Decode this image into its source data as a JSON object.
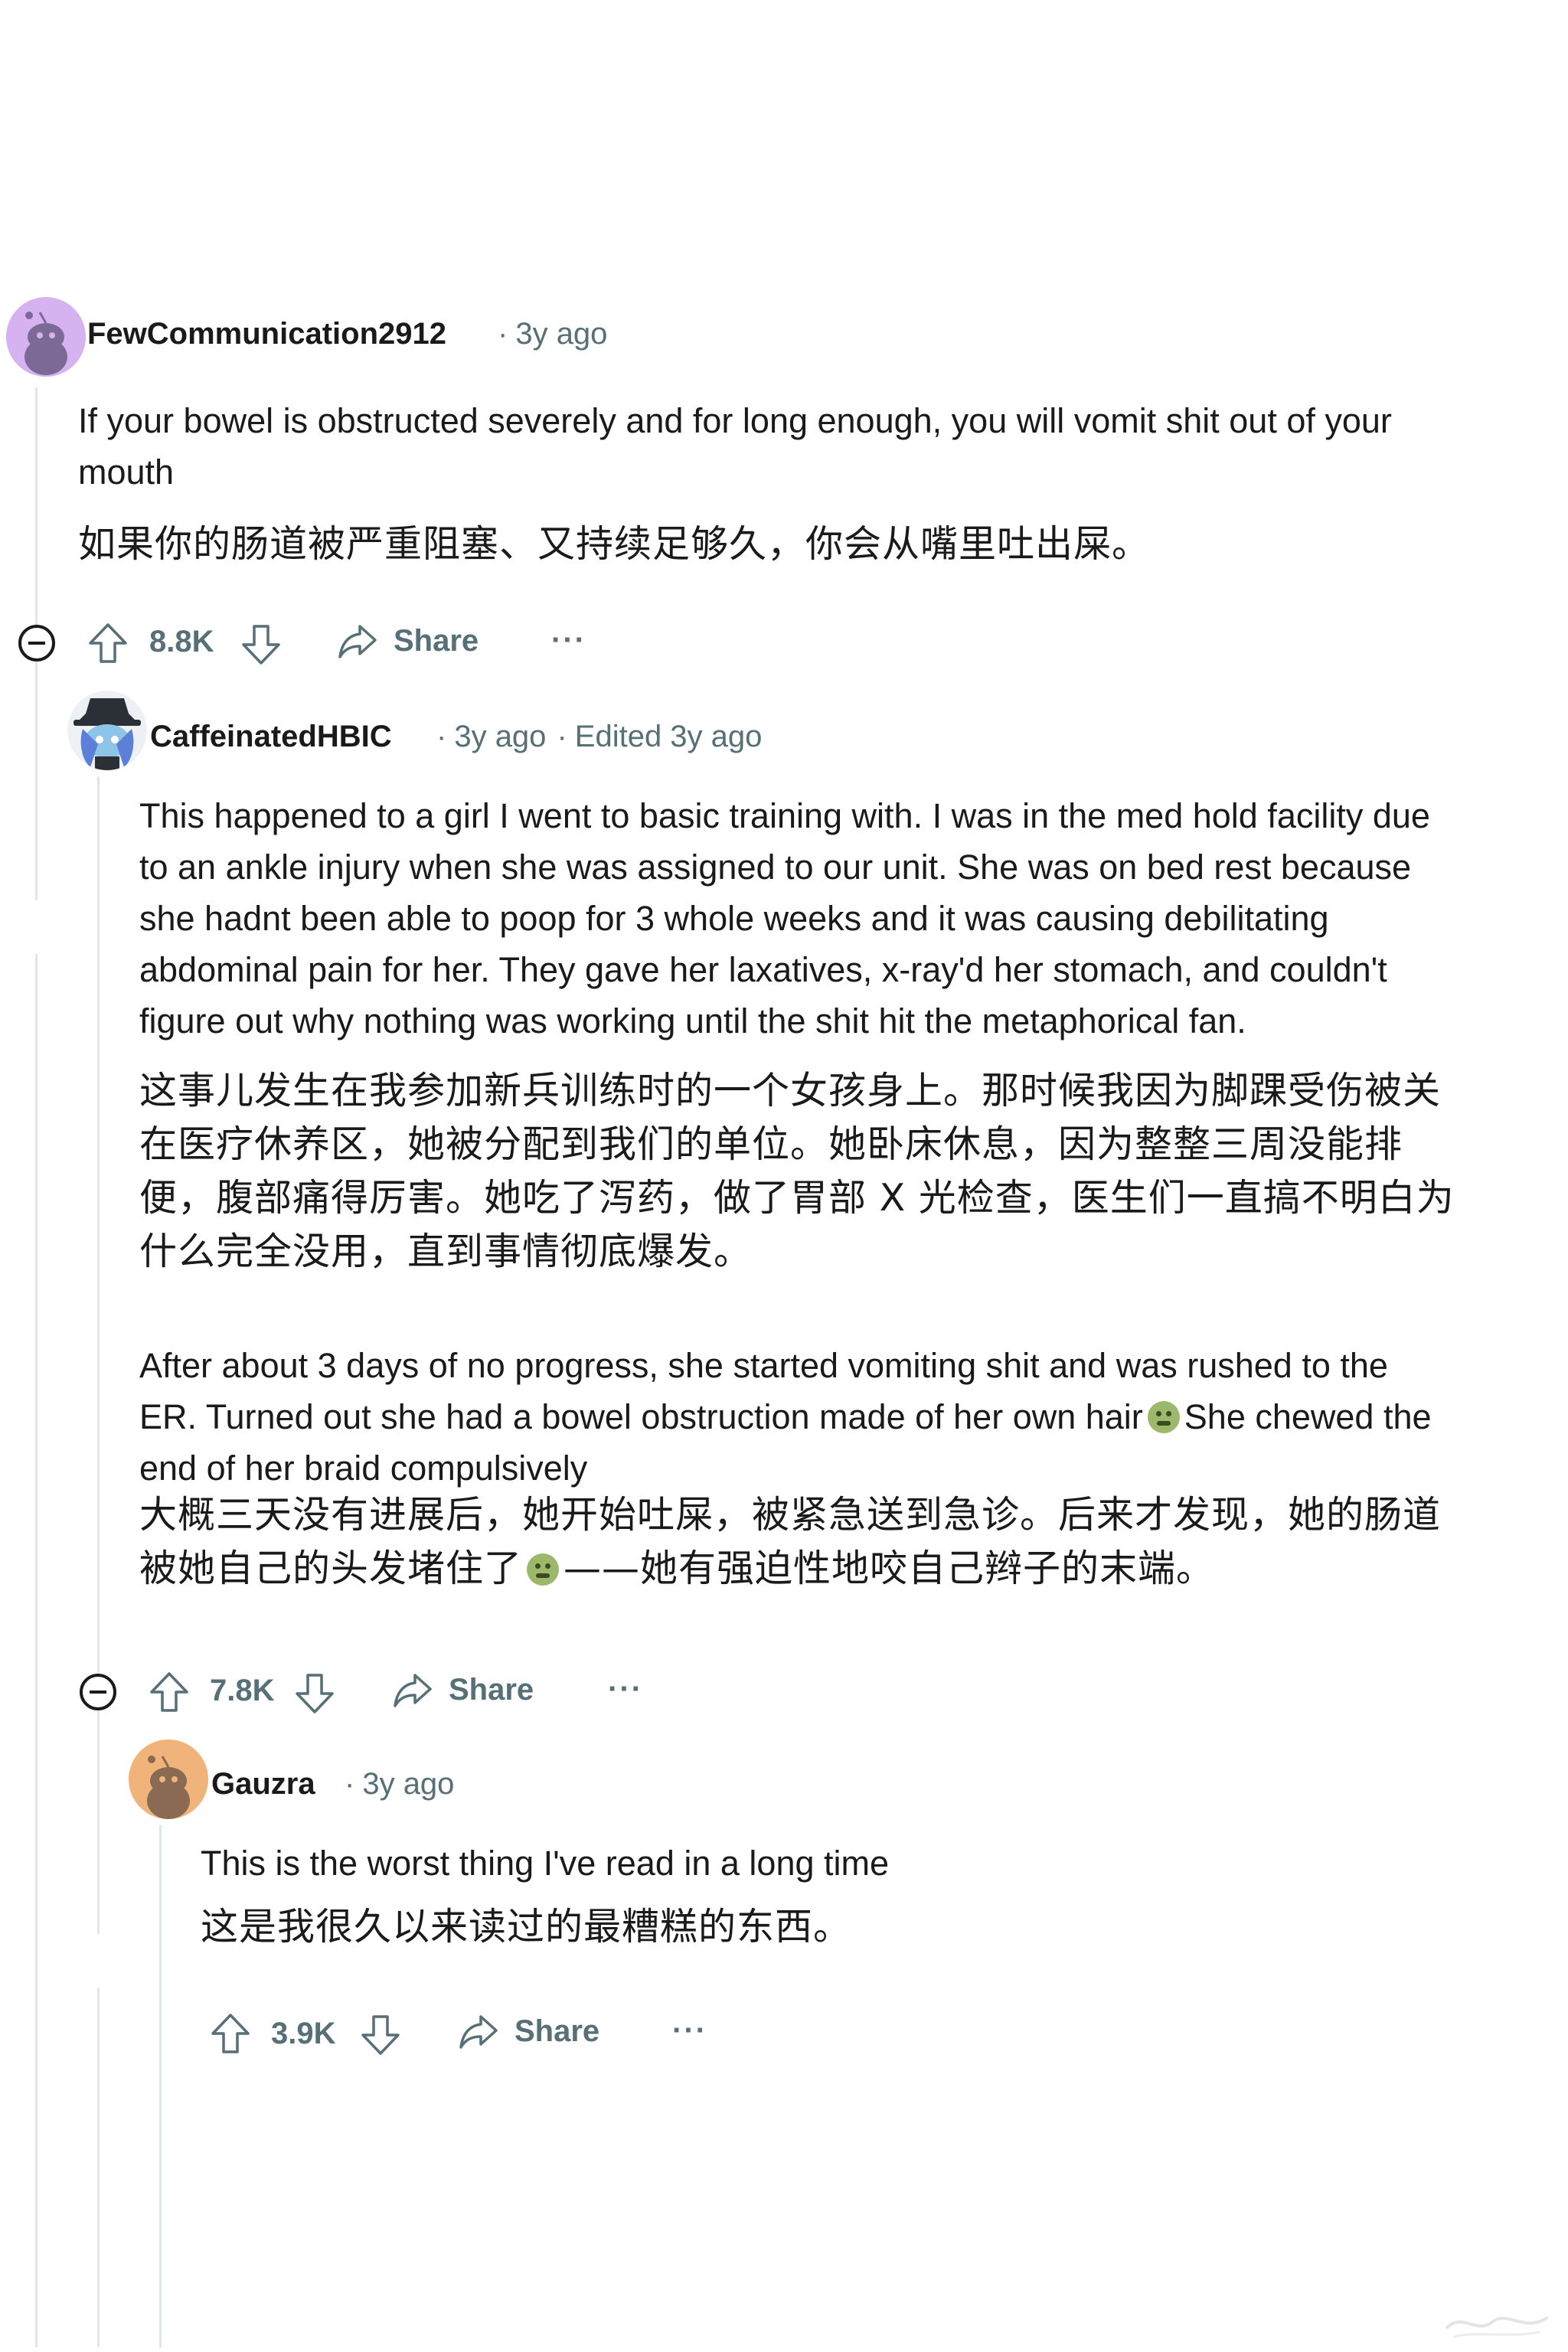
{
  "comments": [
    {
      "username": "FewCommunication2912",
      "time": "3y ago",
      "edited": "",
      "body_en": [
        "If your bowel is obstructed severely and for long enough, you will vomit shit out of your",
        "mouth"
      ],
      "body_zh": [
        "如果你的肠道被严重阻塞、又持续足够久，你会从嘴里吐出屎。"
      ],
      "votes": "8.8K",
      "share": "Share",
      "more": "···"
    },
    {
      "username": "CaffeinatedHBIC",
      "time": "3y ago",
      "edited": "Edited 3y ago",
      "body_en": [
        "This happened to a girl I went to basic training with. I was in the med hold facility due",
        "to an ankle injury when she was assigned to our unit. She was on bed rest because",
        "she hadnt been able to poop for 3 whole weeks and it was causing debilitating",
        "abdominal pain for her. They gave her laxatives, x-ray'd her stomach, and couldn't",
        "figure out why nothing was working until the shit hit the metaphorical fan."
      ],
      "body_zh": [
        "这事儿发生在我参加新兵训练时的一个女孩身上。那时候我因为脚踝受伤被关",
        "在医疗休养区，她被分配到我们的单位。她卧床休息，因为整整三周没能排",
        "便，腹部痛得厉害。她吃了泻药，做了胃部 X 光检查，医生们一直搞不明白为",
        "什么完全没用，直到事情彻底爆发。"
      ],
      "body2_en": [
        "After about 3 days of no progress, she started vomiting shit and was rushed to the",
        "ER. Turned out she had a bowel obstruction made of her own hair",
        "She chewed the",
        "end of her braid compulsively"
      ],
      "body2_zh": [
        "大概三天没有进展后，她开始吐屎，被紧急送到急诊。后来才发现，她的肠道",
        "被她自己的头发堵住了",
        "——她有强迫性地咬自己辫子的末端。"
      ],
      "votes": "7.8K",
      "share": "Share",
      "more": "···"
    },
    {
      "username": "Gauzra",
      "time": "3y ago",
      "edited": "",
      "body_en": [
        "This is the worst thing I've read in a long time"
      ],
      "body_zh": [
        "这是我很久以来读过的最糟糕的东西。"
      ],
      "votes": "3.9K",
      "share": "Share",
      "more": "···"
    }
  ],
  "icons": {
    "collapse": "collapse-minus-icon",
    "upvote": "upvote-arrow-icon",
    "downvote": "downvote-arrow-icon",
    "share": "share-arrow-icon",
    "more": "more-dots-icon",
    "emoji": "nauseated-face-emoji-icon"
  },
  "colors": {
    "text": "#1a1a1b",
    "meta": "#576f76",
    "thread_line": "#e3e6e8",
    "avatar1_bg": "#d6b3f0",
    "avatar3_bg": "#f0b47a"
  }
}
